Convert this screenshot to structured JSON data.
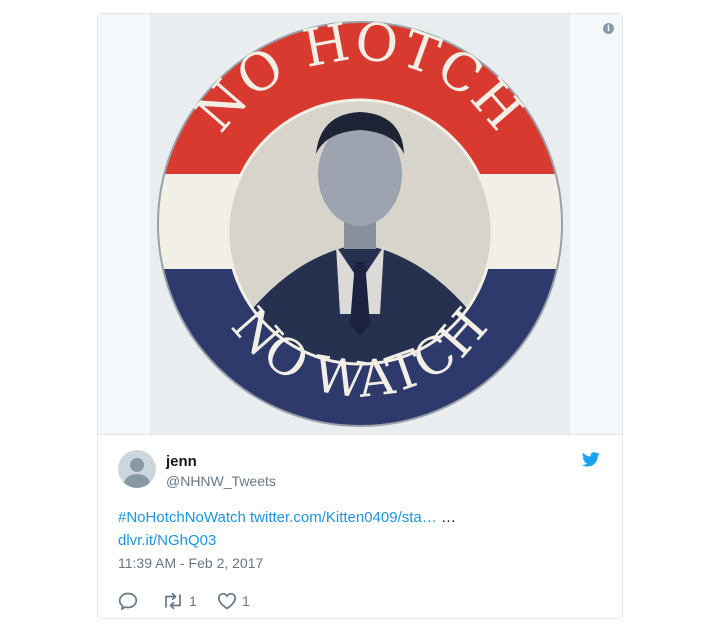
{
  "media": {
    "top_text": "NO HOTCH",
    "bottom_text": "NO WATCH",
    "colors": {
      "red": "#d93a2f",
      "white": "#f2efe6",
      "blue": "#2e3a6b",
      "background": "#f5f8fa"
    }
  },
  "author": {
    "display_name": "jenn",
    "handle": "@NHNW_Tweets"
  },
  "tweet": {
    "hashtag": "#NoHotchNoWatch",
    "link1": "twitter.com/Kitten0409/sta…",
    "ellipsis": "…",
    "link2": "dlvr.it/NGhQ03",
    "timestamp": "11:39 AM - Feb 2, 2017"
  },
  "actions": {
    "reply_icon": "reply-icon",
    "retweet_icon": "retweet-icon",
    "like_icon": "heart-icon",
    "retweet_count": "1",
    "like_count": "1"
  },
  "info_icon_glyph": "i",
  "accent_color": "#1da1f2"
}
